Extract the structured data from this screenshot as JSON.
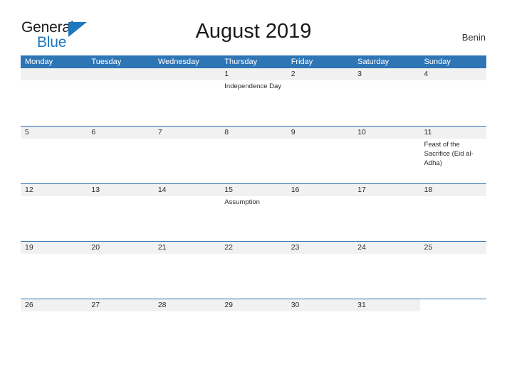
{
  "brand": {
    "word_one": "General",
    "word_two": "Blue",
    "flag_icon": "blue-flag-triangle-icon",
    "blue_hex": "#1f77bd"
  },
  "header": {
    "title": "August 2019",
    "country": "Benin"
  },
  "theme": {
    "header_blue": "#2e75b6",
    "band_gray": "#f1f1f1",
    "text_dark": "#2b2b2b"
  },
  "calendar": {
    "weekdays": [
      "Monday",
      "Tuesday",
      "Wednesday",
      "Thursday",
      "Friday",
      "Saturday",
      "Sunday"
    ],
    "weeks": [
      {
        "band_width_pct": 100,
        "days": [
          {
            "number": "",
            "event": "",
            "empty": true
          },
          {
            "number": "",
            "event": "",
            "empty": true
          },
          {
            "number": "",
            "event": "",
            "empty": true
          },
          {
            "number": "1",
            "event": "Independence Day",
            "empty": false
          },
          {
            "number": "2",
            "event": "",
            "empty": false
          },
          {
            "number": "3",
            "event": "",
            "empty": false
          },
          {
            "number": "4",
            "event": "",
            "empty": false
          }
        ]
      },
      {
        "band_width_pct": 100,
        "days": [
          {
            "number": "5",
            "event": "",
            "empty": false
          },
          {
            "number": "6",
            "event": "",
            "empty": false
          },
          {
            "number": "7",
            "event": "",
            "empty": false
          },
          {
            "number": "8",
            "event": "",
            "empty": false
          },
          {
            "number": "9",
            "event": "",
            "empty": false
          },
          {
            "number": "10",
            "event": "",
            "empty": false
          },
          {
            "number": "11",
            "event": "Feast of the Sacrifice (Eid al-Adha)",
            "empty": false
          }
        ]
      },
      {
        "band_width_pct": 100,
        "days": [
          {
            "number": "12",
            "event": "",
            "empty": false
          },
          {
            "number": "13",
            "event": "",
            "empty": false
          },
          {
            "number": "14",
            "event": "",
            "empty": false
          },
          {
            "number": "15",
            "event": "Assumption",
            "empty": false
          },
          {
            "number": "16",
            "event": "",
            "empty": false
          },
          {
            "number": "17",
            "event": "",
            "empty": false
          },
          {
            "number": "18",
            "event": "",
            "empty": false
          }
        ]
      },
      {
        "band_width_pct": 100,
        "days": [
          {
            "number": "19",
            "event": "",
            "empty": false
          },
          {
            "number": "20",
            "event": "",
            "empty": false
          },
          {
            "number": "21",
            "event": "",
            "empty": false
          },
          {
            "number": "22",
            "event": "",
            "empty": false
          },
          {
            "number": "23",
            "event": "",
            "empty": false
          },
          {
            "number": "24",
            "event": "",
            "empty": false
          },
          {
            "number": "25",
            "event": "",
            "empty": false
          }
        ]
      },
      {
        "band_width_pct": 85.7143,
        "days": [
          {
            "number": "26",
            "event": "",
            "empty": false
          },
          {
            "number": "27",
            "event": "",
            "empty": false
          },
          {
            "number": "28",
            "event": "",
            "empty": false
          },
          {
            "number": "29",
            "event": "",
            "empty": false
          },
          {
            "number": "30",
            "event": "",
            "empty": false
          },
          {
            "number": "31",
            "event": "",
            "empty": false
          },
          {
            "number": "",
            "event": "",
            "empty": true
          }
        ]
      }
    ]
  }
}
